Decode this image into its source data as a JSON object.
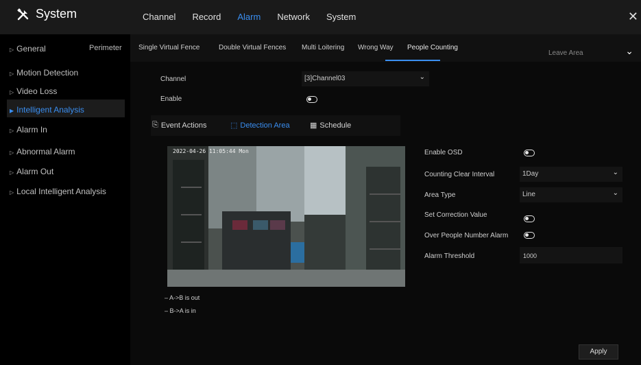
{
  "app": {
    "title": "System"
  },
  "main_nav": [
    "Channel",
    "Record",
    "Alarm",
    "Network",
    "System"
  ],
  "active_nav": "Alarm",
  "sidebar": {
    "items": [
      {
        "label": "General"
      },
      {
        "label": "Motion Detection"
      },
      {
        "label": "Video Loss"
      },
      {
        "label": "Intelligent Analysis"
      },
      {
        "label": "Alarm In"
      },
      {
        "label": "Abnormal Alarm"
      },
      {
        "label": "Alarm Out"
      },
      {
        "label": "Local Intelligent Analysis"
      }
    ],
    "sub_label": "Perimeter"
  },
  "sub_tabs": [
    "Single Virtual Fence",
    "Double Virtual Fences",
    "Multi Loitering",
    "Wrong Way",
    "People Counting"
  ],
  "active_sub_tab": "People Counting",
  "leave_area": "Leave Area",
  "form": {
    "channel_label": "Channel",
    "channel_value": "[3]Channel03",
    "enable_label": "Enable"
  },
  "inner_tabs": [
    "Event Actions",
    "Detection Area",
    "Schedule"
  ],
  "active_inner_tab": "Detection Area",
  "video": {
    "timestamp": "2022-04-26 11:05:44 Mon"
  },
  "legend": [
    "A->B is out",
    "B->A is in"
  ],
  "settings": {
    "enable_osd": "Enable OSD",
    "counting_clear_interval": "Counting Clear Interval",
    "counting_clear_interval_value": "1Day",
    "area_type": "Area Type",
    "area_type_value": "Line",
    "set_correction_value": "Set Correction Value",
    "over_people_number_alarm": "Over People Number Alarm",
    "alarm_threshold": "Alarm Threshold",
    "alarm_threshold_value": "1000"
  },
  "apply_label": "Apply",
  "colors": {
    "accent": "#3a8ef0",
    "background": "#000000",
    "panel": "#141414"
  }
}
